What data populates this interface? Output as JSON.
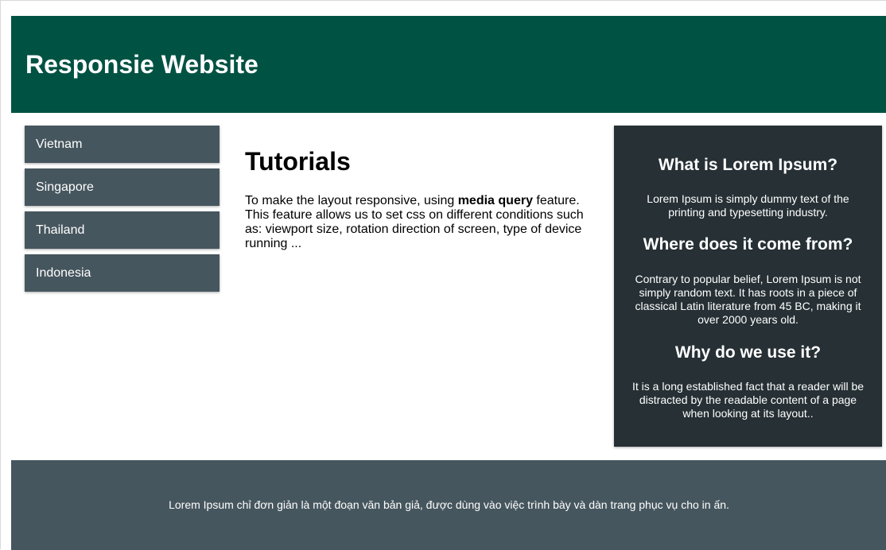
{
  "header": {
    "title": "Responsie Website",
    "background": "#005243"
  },
  "nav": {
    "items": [
      {
        "label": "Vietnam"
      },
      {
        "label": "Singapore"
      },
      {
        "label": "Thailand"
      },
      {
        "label": "Indonesia"
      }
    ],
    "background": "#46565e"
  },
  "main": {
    "title": "Tutorials",
    "text_before": "To make the layout responsive, using ",
    "text_bold": "media query",
    "text_after": " feature. This feature allows us to set css on different conditions such as: viewport size, rotation direction of screen, type of device running ..."
  },
  "aside": {
    "background": "#263035",
    "sections": [
      {
        "heading": "What is Lorem Ipsum?",
        "text": "Lorem Ipsum is simply dummy text of the printing and typesetting industry."
      },
      {
        "heading": "Where does it come from?",
        "text": "Contrary to popular belief, Lorem Ipsum is not simply random text. It has roots in a piece of classical Latin literature from 45 BC, making it over 2000 years old."
      },
      {
        "heading": "Why do we use it?",
        "text": "It is a long established fact that a reader will be distracted by the readable content of a page when looking at its layout.."
      }
    ]
  },
  "footer": {
    "text": "Lorem Ipsum chỉ đơn giản là một đoạn văn bản giả, được dùng vào việc trình bày và dàn trang phục vụ cho in ấn.",
    "background": "#46565e"
  }
}
